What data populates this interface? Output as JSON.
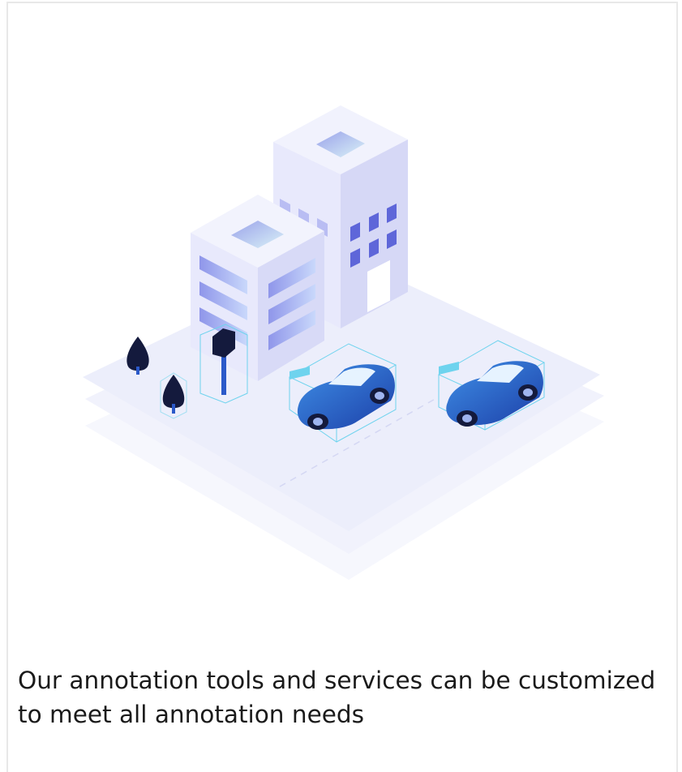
{
  "card": {
    "caption": "Our annotation tools and services can be customized to meet all annotation needs"
  },
  "illustration": {
    "subject": "isometric city block with annotated objects",
    "colors": {
      "platform": "#eef0fb",
      "building": "#e7e8fb",
      "building_side": "#d3d5f5",
      "window": "#9fa6ee",
      "tree": "#141a3d",
      "car": "#2f73d9",
      "bbox": "#6ed3ee"
    }
  }
}
